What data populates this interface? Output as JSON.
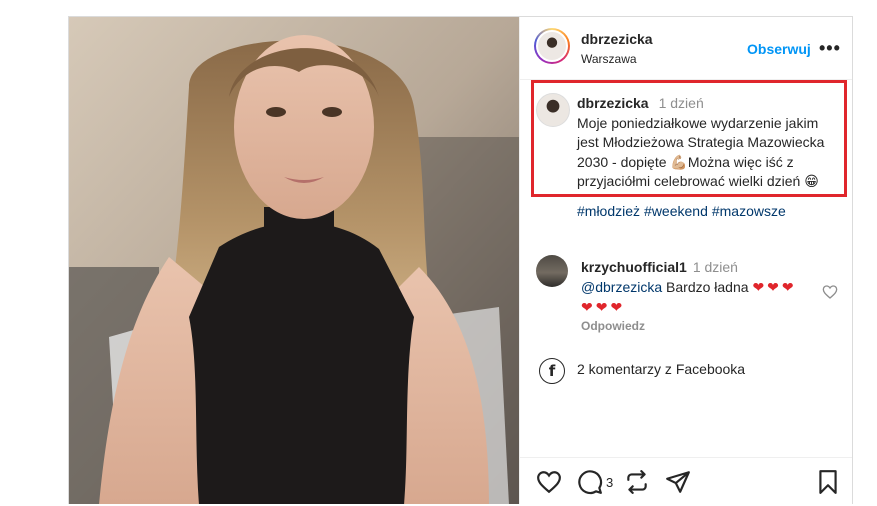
{
  "header": {
    "username": "dbrzezicka",
    "location": "Warszawa",
    "follow_label": "Obserwuj",
    "more_label": "•••"
  },
  "caption": {
    "username": "dbrzezicka",
    "time": "1 dzień",
    "text": "Moje poniedziałkowe wydarzenie jakim jest Młodzieżowa Strategia Mazowiecka 2030 - dopięte 💪🏼Można więc iść z przyjaciółmi celebrować wielki dzień 😁",
    "hashtags": [
      "#młodzież",
      "#weekend",
      "#mazowsze"
    ]
  },
  "comment": {
    "username": "krzychuofficial1",
    "time": "1 dzień",
    "mention": "@dbrzezicka",
    "text": "Bardzo ładna",
    "hearts": "❤❤❤ ❤❤❤",
    "reply_label": "Odpowiedz"
  },
  "facebook_comments": "2 komentarzy z Facebooka",
  "actions": {
    "comment_count": "3"
  },
  "colors": {
    "accent": "#0095f6",
    "highlight_border": "#e0262c",
    "hashtag": "#00376b"
  }
}
